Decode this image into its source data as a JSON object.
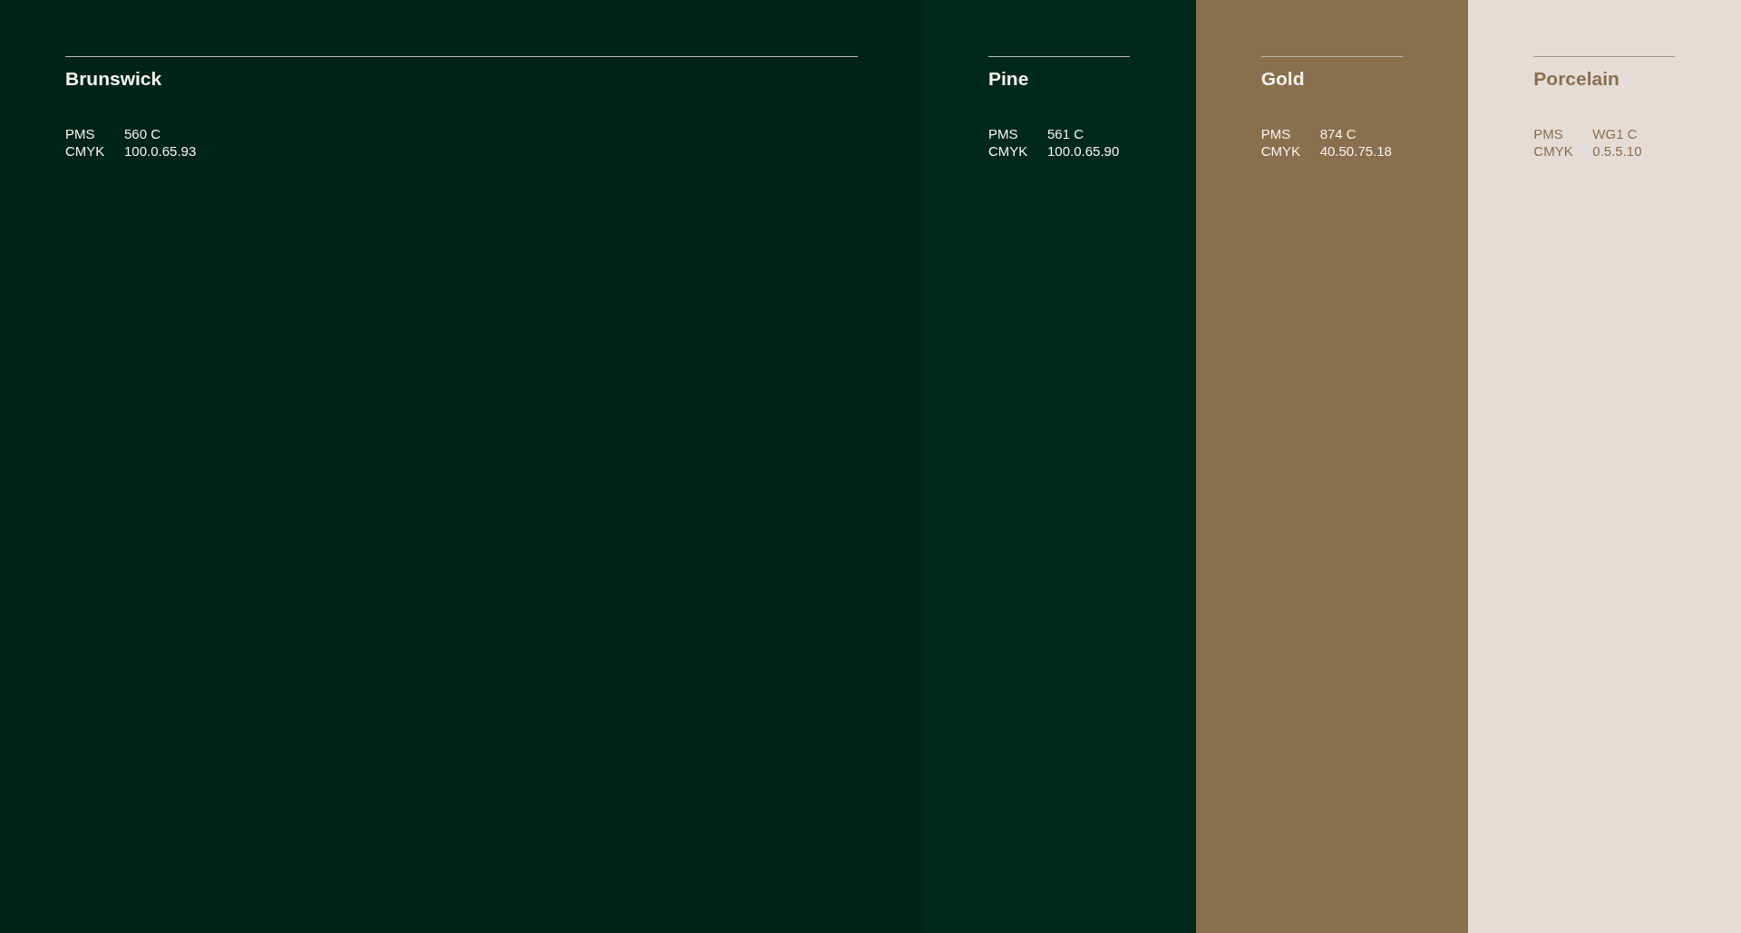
{
  "swatches": [
    {
      "name": "Brunswick",
      "color": "#002418",
      "primary": true,
      "light": false,
      "specs": [
        {
          "label": "PMS",
          "value": "560 C"
        },
        {
          "label": "CMYK",
          "value": "100.0.65.93"
        }
      ]
    },
    {
      "name": "Pine",
      "color": "#00291c",
      "primary": false,
      "light": false,
      "specs": [
        {
          "label": "PMS",
          "value": "561 C"
        },
        {
          "label": "CMYK",
          "value": "100.0.65.90"
        }
      ]
    },
    {
      "name": "Gold",
      "color": "#8a6f4e",
      "primary": false,
      "light": false,
      "specs": [
        {
          "label": "PMS",
          "value": "874 C"
        },
        {
          "label": "CMYK",
          "value": "40.50.75.18"
        }
      ]
    },
    {
      "name": "Porcelain",
      "color": "#e6dcd7",
      "primary": false,
      "light": true,
      "specs": [
        {
          "label": "PMS",
          "value": "WG1 C"
        },
        {
          "label": "CMYK",
          "value": "0.5.5.10"
        }
      ]
    }
  ]
}
